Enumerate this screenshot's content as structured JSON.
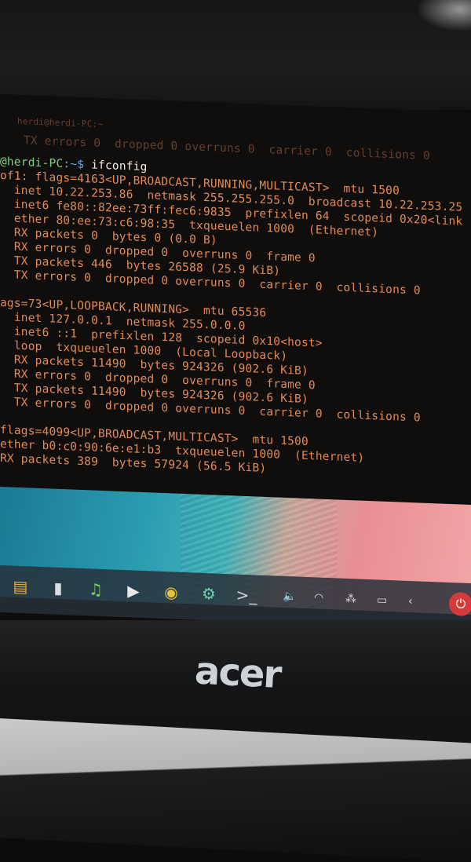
{
  "brand": {
    "logo_text": "acer"
  },
  "terminal": {
    "faded_lines": [
      "herdi@herdi-PC:~",
      "TX errors 0  dropped 0 overruns 0  carrier 0  collisions 0"
    ],
    "prompt": {
      "user_host": "@herdi-PC",
      "path": ":~$",
      "command": " ifconfig"
    },
    "lines": [
      "of1: flags=4163<UP,BROADCAST,RUNNING,MULTICAST>  mtu 1500",
      "  inet 10.22.253.86  netmask 255.255.255.0  broadcast 10.22.253.25",
      "  inet6 fe80::82ee:73ff:fec6:9835  prefixlen 64  scopeid 0x20<link",
      "  ether 80:ee:73:c6:98:35  txqueuelen 1000  (Ethernet)",
      "  RX packets 0  bytes 0 (0.0 B)",
      "  RX errors 0  dropped 0  overruns 0  frame 0",
      "  TX packets 446  bytes 26588 (25.9 KiB)",
      "  TX errors 0  dropped 0 overruns 0  carrier 0  collisions 0",
      "",
      "ags=73<UP,LOOPBACK,RUNNING>  mtu 65536",
      "  inet 127.0.0.1  netmask 255.0.0.0",
      "  inet6 ::1  prefixlen 128  scopeid 0x10<host>",
      "  loop  txqueuelen 1000  (Local Loopback)",
      "  RX packets 11490  bytes 924326 (902.6 KiB)",
      "  RX errors 0  dropped 0  overruns 0  frame 0",
      "  TX packets 11490  bytes 924326 (902.6 KiB)",
      "  TX errors 0  dropped 0 overruns 0  carrier 0  collisions 0",
      "",
      "flags=4099<UP,BROADCAST,MULTICAST>  mtu 1500",
      "ether b0:c0:90:6e:e1:b3  txqueuelen 1000  (Ethernet)",
      "RX packets 389  bytes 57924 (56.5 KiB)"
    ]
  },
  "taskbar": {
    "apps": [
      {
        "name": "file-manager-icon",
        "glyph": "▤",
        "color": "#e0b04a"
      },
      {
        "name": "app-store-icon",
        "glyph": "▮",
        "color": "#d8dde3"
      },
      {
        "name": "music-icon",
        "glyph": "♫",
        "color": "#7cd35a"
      },
      {
        "name": "video-player-icon",
        "glyph": "▶",
        "color": "#e8e8e8"
      },
      {
        "name": "chrome-icon",
        "glyph": "◉",
        "color": "#e8c23a"
      },
      {
        "name": "settings-icon",
        "glyph": "⚙",
        "color": "#6fd0b0"
      },
      {
        "name": "terminal-icon",
        "glyph": ">_",
        "color": "#cfd6dd"
      }
    ],
    "tray": [
      {
        "name": "volume-icon",
        "glyph": "🔈"
      },
      {
        "name": "wifi-icon",
        "glyph": "◠"
      },
      {
        "name": "network-icon",
        "glyph": "⁂"
      },
      {
        "name": "battery-icon",
        "glyph": "▭"
      },
      {
        "name": "collapse-icon",
        "glyph": "‹"
      }
    ],
    "power_glyph": "⏻"
  }
}
